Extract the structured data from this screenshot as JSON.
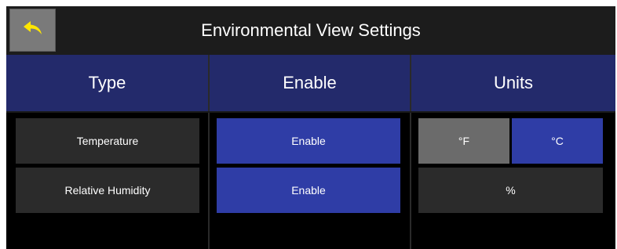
{
  "header": {
    "title": "Environmental View Settings",
    "back_icon": "back-arrow-icon"
  },
  "columns": {
    "type": "Type",
    "enable": "Enable",
    "units": "Units"
  },
  "rows": [
    {
      "type": "Temperature",
      "enable": "Enable",
      "units": [
        {
          "label": "°F",
          "selected": false
        },
        {
          "label": "°C",
          "selected": true
        }
      ]
    },
    {
      "type": "Relative Humidity",
      "enable": "Enable",
      "units": [
        {
          "label": "%",
          "selected": false
        }
      ]
    }
  ],
  "colors": {
    "header_bar": "#232a6b",
    "active_button": "#2f3da6",
    "inactive_button": "#6b6b6b",
    "back_arrow": "#ffe600"
  }
}
